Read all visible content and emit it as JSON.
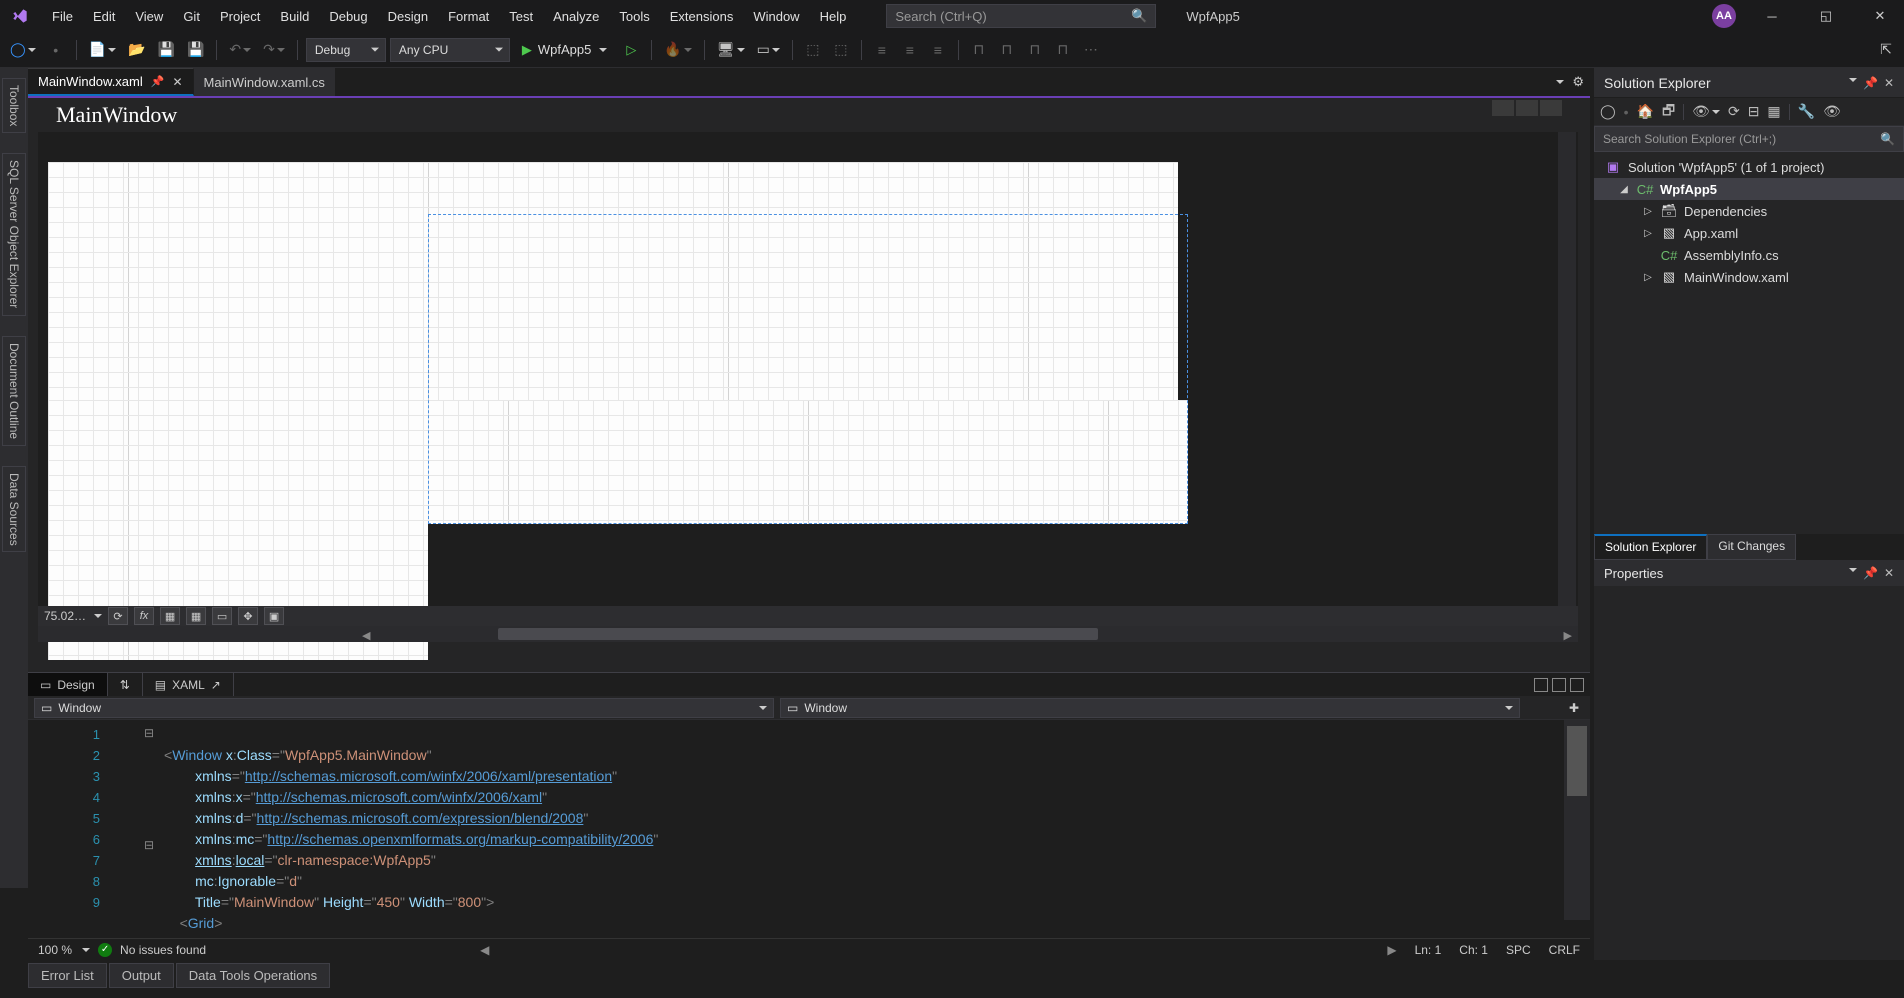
{
  "menu": {
    "items": [
      "File",
      "Edit",
      "View",
      "Git",
      "Project",
      "Build",
      "Debug",
      "Design",
      "Format",
      "Test",
      "Analyze",
      "Tools",
      "Extensions",
      "Window",
      "Help"
    ]
  },
  "search": {
    "placeholder": "Search (Ctrl+Q)"
  },
  "app_title": "WpfApp5",
  "user_initials": "AA",
  "toolbar": {
    "config": "Debug",
    "platform": "Any CPU",
    "run_target": "WpfApp5"
  },
  "left_rail": [
    "Toolbox",
    "SQL Server Object Explorer",
    "Document Outline",
    "Data Sources"
  ],
  "doc_tabs": {
    "active": "MainWindow.xaml",
    "inactive": "MainWindow.xaml.cs"
  },
  "designer": {
    "window_title": "MainWindow",
    "zoom": "75.02…"
  },
  "split": {
    "design_label": "Design",
    "xaml_label": "XAML"
  },
  "breadcrumb": {
    "left": "Window",
    "right": "Window"
  },
  "code_lines": [
    1,
    2,
    3,
    4,
    5,
    6,
    7,
    8,
    9
  ],
  "code": {
    "l1_a": "<",
    "l1_b": "Window",
    "l1_c": " x",
    "l1_d": ":",
    "l1_e": "Class",
    "l1_f": "=\"",
    "l1_g": "WpfApp5.MainWindow",
    "l1_h": "\"",
    "l2_a": "xmlns",
    "l2_b": "=\"",
    "l2_c": "http://schemas.microsoft.com/winfx/2006/xaml/presentation",
    "l2_d": "\"",
    "l3_a": "xmlns",
    "l3_b": ":",
    "l3_c": "x",
    "l3_d": "=\"",
    "l3_e": "http://schemas.microsoft.com/winfx/2006/xaml",
    "l3_f": "\"",
    "l4_a": "xmlns",
    "l4_b": ":",
    "l4_c": "d",
    "l4_d": "=\"",
    "l4_e": "http://schemas.microsoft.com/expression/blend/2008",
    "l4_f": "\"",
    "l5_a": "xmlns",
    "l5_b": ":",
    "l5_c": "mc",
    "l5_d": "=\"",
    "l5_e": "http://schemas.openxmlformats.org/markup-compatibility/2006",
    "l5_f": "\"",
    "l6_a": "xmlns",
    "l6_b": ":",
    "l6_c": "local",
    "l6_d": "=\"",
    "l6_e": "clr-namespace:WpfApp5",
    "l6_f": "\"",
    "l7_a": "mc",
    "l7_b": ":",
    "l7_c": "Ignorable",
    "l7_d": "=\"",
    "l7_e": "d",
    "l7_f": "\"",
    "l8_a": "Title",
    "l8_b": "=\"",
    "l8_c": "MainWindow",
    "l8_d": "\" ",
    "l8_e": "Height",
    "l8_f": "=\"",
    "l8_g": "450",
    "l8_h": "\" ",
    "l8_i": "Width",
    "l8_j": "=\"",
    "l8_k": "800",
    "l8_l": "\">",
    "l9_a": "<",
    "l9_b": "Grid",
    "l9_c": ">"
  },
  "editor_status": {
    "zoom": "100 %",
    "issues": "No issues found",
    "ln": "Ln: 1",
    "ch": "Ch: 1",
    "spc": "SPC",
    "eol": "CRLF"
  },
  "bottom_tabs": [
    "Error List",
    "Output",
    "Data Tools Operations"
  ],
  "solution_explorer": {
    "title": "Solution Explorer",
    "search_placeholder": "Search Solution Explorer (Ctrl+;)",
    "root": "Solution 'WpfApp5' (1 of 1 project)",
    "project": "WpfApp5",
    "items": [
      "Dependencies",
      "App.xaml",
      "AssemblyInfo.cs",
      "MainWindow.xaml"
    ],
    "tab_se": "Solution Explorer",
    "tab_git": "Git Changes"
  },
  "properties": {
    "title": "Properties"
  }
}
